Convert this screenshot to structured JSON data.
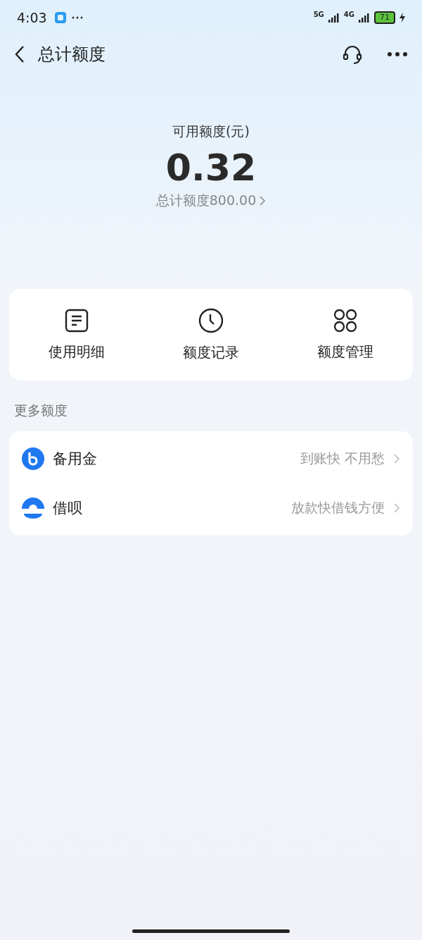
{
  "status_bar": {
    "time": "4:03",
    "network_1": "5G",
    "network_2": "4G",
    "battery": "71"
  },
  "nav": {
    "title": "总计额度"
  },
  "balance": {
    "label": "可用额度(元)",
    "amount": "0.32",
    "total": "总计额度800.00"
  },
  "actions": [
    {
      "kind": "list",
      "label": "使用明细"
    },
    {
      "kind": "clock",
      "label": "额度记录"
    },
    {
      "kind": "grid",
      "label": "额度管理"
    }
  ],
  "more": {
    "title": "更多额度",
    "items": [
      {
        "kind": "b",
        "name": "备用金",
        "hint": "到账快 不用愁"
      },
      {
        "kind": "person",
        "name": "借呗",
        "hint": "放款快借钱方便"
      }
    ]
  }
}
